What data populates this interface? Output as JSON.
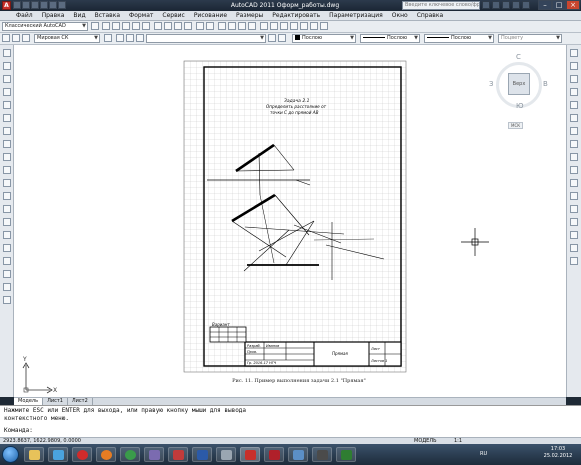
{
  "window": {
    "title": "AutoCAD 2011   Оформ_работы.dwg",
    "search_placeholder": "Введите ключевое слово/фразу",
    "app_badge": "A",
    "min": "–",
    "max": "□",
    "close": "×"
  },
  "menu": [
    "Файл",
    "Правка",
    "Вид",
    "Вставка",
    "Формат",
    "Сервис",
    "Рисование",
    "Размеры",
    "Редактировать",
    "Параметризация",
    "Окно",
    "Справка"
  ],
  "toolbar1": {
    "workspace": "Классический AutoCAD",
    "layer_color_label": "Послою",
    "linetype_label": "Послою",
    "lineweight_label": "Послою",
    "plotstyle_label": "Поцвету"
  },
  "toolbar2": {
    "ucs": "Мировая СК"
  },
  "viewcube": {
    "north": "С",
    "south": "Ю",
    "east": "В",
    "west": "З",
    "face": "Верх",
    "wcs": "МСК"
  },
  "drawing": {
    "task_title": "Задача 2.1",
    "task_line2": "Определить расстояние от",
    "task_line3": "точки С до прямой AB",
    "caption": "Рис. 11.  Пример выполнения задачи 2.1 \"Прямая\"",
    "variant_label": "Вариант",
    "stamp_developed": "Разраб.",
    "stamp_checked": "Пров.",
    "stamp_name": "Иванов",
    "stamp_group": "Гр. 2016-17 НГЧ",
    "stamp_title": "Прямая",
    "stamp_sheet": "Лист",
    "stamp_sheets": "Листов 1",
    "ucs_y": "Y",
    "ucs_x": "X"
  },
  "tabs": [
    "Модель",
    "Лист1",
    "Лист2"
  ],
  "command": {
    "line1": "Нажмите ESC или ENTER для выхода, или правую кнопку мыши для вывода",
    "line2": "контекстного меню.",
    "prompt": "Команда:"
  },
  "status": {
    "coords": "2923.8637, 1622.9809, 0.0000",
    "model": "МОДЕЛЬ",
    "scale": "1:1"
  },
  "taskbar": {
    "lang": "RU",
    "time": "17:03",
    "date": "25.02.2012"
  },
  "colors": {
    "accent": "#c8302a",
    "titlebar": "#1b2634",
    "taskbar": "#1d2b3a"
  }
}
